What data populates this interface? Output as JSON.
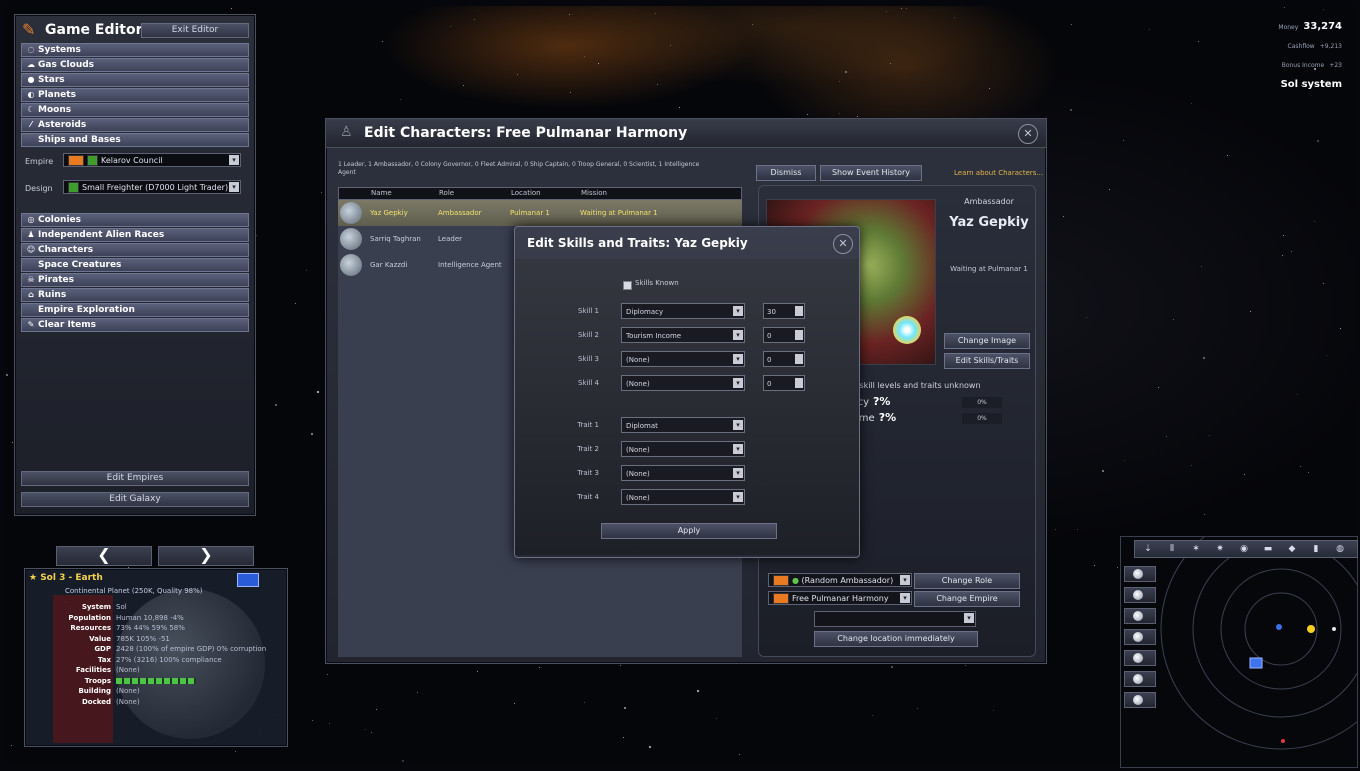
{
  "editor": {
    "title": "Game Editor",
    "exit_label": "Exit Editor",
    "categories": [
      {
        "label": "Systems",
        "icon": "systems-icon",
        "glyph": "◌"
      },
      {
        "label": "Gas Clouds",
        "icon": "gas-cloud-icon",
        "glyph": "☁"
      },
      {
        "label": "Stars",
        "icon": "star-icon",
        "glyph": "●"
      },
      {
        "label": "Planets",
        "icon": "planet-icon",
        "glyph": "◐"
      },
      {
        "label": "Moons",
        "icon": "moon-icon",
        "glyph": "☾"
      },
      {
        "label": "Asteroids",
        "icon": "asteroid-icon",
        "glyph": "⁄"
      },
      {
        "label": "Ships and Bases",
        "icon": "ship-icon",
        "glyph": ""
      }
    ],
    "empire_label": "Empire",
    "empire_value": "Kelarov Council",
    "design_label": "Design",
    "design_value": "Small Freighter (D7000 Light Trader)",
    "categories2": [
      {
        "label": "Colonies",
        "icon": "colony-icon",
        "glyph": "◎"
      },
      {
        "label": "Independent Alien Races",
        "icon": "alien-race-icon",
        "glyph": "♟"
      },
      {
        "label": "Characters",
        "icon": "character-icon",
        "glyph": "☺"
      },
      {
        "label": "Space Creatures",
        "icon": "creature-icon",
        "glyph": ""
      },
      {
        "label": "Pirates",
        "icon": "pirate-icon",
        "glyph": "☠"
      },
      {
        "label": "Ruins",
        "icon": "ruins-icon",
        "glyph": "⌂"
      },
      {
        "label": "Empire Exploration",
        "icon": "exploration-icon",
        "glyph": ""
      },
      {
        "label": "Clear Items",
        "icon": "clear-icon",
        "glyph": "✎"
      }
    ],
    "edit_empires_label": "Edit Empires",
    "edit_galaxy_label": "Edit Galaxy"
  },
  "topright": {
    "money_label": "Money",
    "money_value": "33,274",
    "cashflow_label": "Cashflow",
    "cashflow_value": "+9,213",
    "bonus_label": "Bonus Income",
    "bonus_value": "+23",
    "system_name": "Sol system"
  },
  "planet": {
    "title": "Sol 3 - Earth",
    "subtitle": "Continental Planet (250K, Quality 98%)",
    "rows": [
      {
        "k": "System",
        "v": "Sol"
      },
      {
        "k": "Population",
        "v": "Human   10,898   -4%"
      },
      {
        "k": "Resources",
        "v": "73%  44%  59%  58%"
      },
      {
        "k": "Value",
        "v": "785K   105%   -51"
      },
      {
        "k": "GDP",
        "v": "2428 (100% of empire GDP) 0% corruption"
      },
      {
        "k": "Tax",
        "v": "27% (3216) 100% compliance"
      },
      {
        "k": "Facilities",
        "v": "(None)"
      },
      {
        "k": "Troops",
        "v": ""
      },
      {
        "k": "Building",
        "v": "(None)"
      },
      {
        "k": "Docked",
        "v": "(None)"
      }
    ],
    "prev_glyph": "❮",
    "next_glyph": "❯"
  },
  "characters": {
    "title": "Edit Characters: Free Pulmanar Harmony",
    "summary": "1 Leader, 1 Ambassador, 0 Colony Governor, 0 Fleet Admiral, 0 Ship Captain, 0 Troop General, 0 Scientist, 1 Intelligence Agent",
    "columns": [
      "Name",
      "Role",
      "Location",
      "Mission"
    ],
    "rows": [
      {
        "name": "Yaz Gepkiy",
        "role": "Ambassador",
        "location": "Pulmanar 1",
        "mission": "Waiting at Pulmanar 1"
      },
      {
        "name": "Sarriq Taghran",
        "role": "Leader",
        "location": "",
        "mission": ""
      },
      {
        "name": "Gar Kazzdi",
        "role": "Intelligence Agent",
        "location": "",
        "mission": ""
      }
    ],
    "dismiss_label": "Dismiss",
    "event_history_label": "Show Event History",
    "learn_label": "Learn about Characters...",
    "selected_role": "Ambassador",
    "selected_name": "Yaz Gepkiy",
    "selected_location": "Waiting at Pulmanar 1",
    "change_image_label": "Change Image",
    "edit_skills_label": "Edit Skills/Traits",
    "skill_note": "- skill levels and traits unknown",
    "skill_rows": [
      {
        "label": "Diplomacy",
        "value": "?%",
        "pct": "0%"
      },
      {
        "label": "Tourism Income",
        "value": "?%",
        "pct": "0%"
      }
    ],
    "role_combo": "(Random Ambassador)",
    "empire_combo": "Free Pulmanar Harmony",
    "change_role_label": "Change Role",
    "change_empire_label": "Change Empire",
    "location_combo": "",
    "change_location_label": "Change location immediately"
  },
  "skills_dialog": {
    "title": "Edit Skills and Traits: Yaz Gepkiy",
    "skills_known_label": "Skills Known",
    "skills": [
      {
        "label": "Skill 1",
        "value": "Diplomacy",
        "amount": "30"
      },
      {
        "label": "Skill 2",
        "value": "Tourism Income",
        "amount": "0"
      },
      {
        "label": "Skill 3",
        "value": "(None)",
        "amount": "0"
      },
      {
        "label": "Skill 4",
        "value": "(None)",
        "amount": "0"
      }
    ],
    "traits": [
      {
        "label": "Trait 1",
        "value": "Diplomat"
      },
      {
        "label": "Trait 2",
        "value": "(None)"
      },
      {
        "label": "Trait 3",
        "value": "(None)"
      },
      {
        "label": "Trait 4",
        "value": "(None)"
      }
    ],
    "apply_label": "Apply"
  }
}
